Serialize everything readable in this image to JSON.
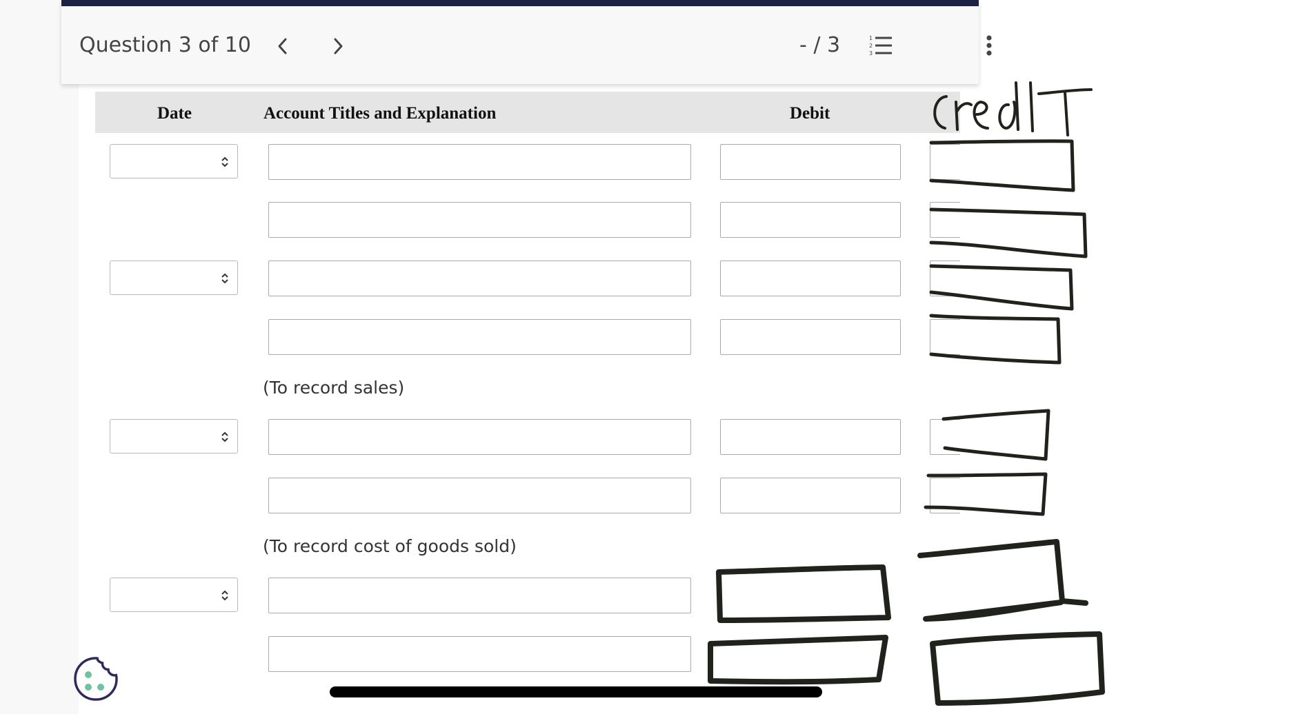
{
  "header": {
    "question_label": "Question 3 of 10",
    "score": "- / 3",
    "icons": [
      "chevron-left-icon",
      "chevron-right-icon",
      "numbered-list-icon",
      "more-vertical-icon"
    ]
  },
  "table": {
    "columns": [
      "Date",
      "Account Titles and Explanation",
      "Debit",
      "Credit"
    ]
  },
  "entries": [
    {
      "lines": 2,
      "note": ""
    },
    {
      "lines": 2,
      "note": "(To record sales)"
    },
    {
      "lines": 2,
      "note": "(To record cost of goods sold)"
    },
    {
      "lines": 2,
      "note": ""
    }
  ],
  "notes": {
    "sales": "(To record sales)",
    "cogs": "(To record cost of goods sold)"
  },
  "annotation": {
    "handwritten_text": "credIT",
    "ink_color": "#1f231c"
  },
  "colors": {
    "header_bar": "#1c2143",
    "table_head": "#e5e5e5",
    "cookie_icon": "#2e2a5c",
    "cookie_dots": "#6ec4a0"
  }
}
